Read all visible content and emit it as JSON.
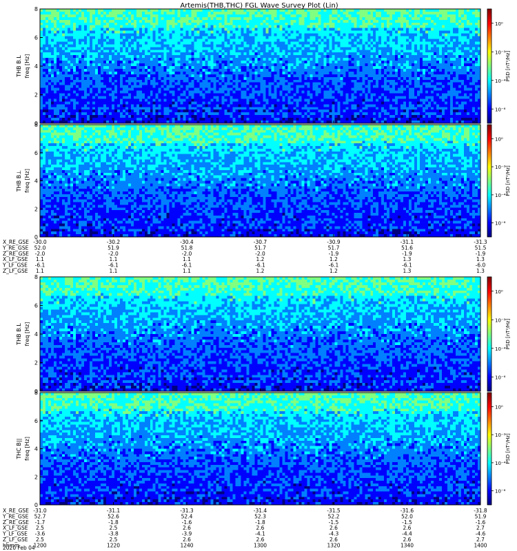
{
  "title": "Artemis(THB,THC) FGL Wave Survey Plot (Lin)",
  "colormap": [
    "#00007f",
    "#0000ff",
    "#0080ff",
    "#00ffff",
    "#80ff80",
    "#ffff00",
    "#ff8000",
    "#ff0000",
    "#7f0000"
  ],
  "chart_data": [
    {
      "type": "heatmap",
      "panel": "p1",
      "probe": "THB",
      "ylabel": "freq [Hz]",
      "band_label": "THB B.L",
      "colorbar_label": "PSD [nT²/Hz]",
      "colorbar_ticks": [
        "10⁰",
        "10⁻²",
        "10⁻⁴",
        "10⁻⁶"
      ],
      "ylim": [
        0,
        8
      ],
      "yticks": [
        "0",
        "2",
        "4",
        "6",
        "8"
      ],
      "zscale": "log",
      "zlim_exp": [
        -7,
        1
      ],
      "xlim": [
        "1200",
        "1400"
      ]
    },
    {
      "type": "heatmap",
      "panel": "p2",
      "probe": "THB",
      "ylabel": "freq [Hz]",
      "band_label": "THB B⊥",
      "colorbar_label": "PSD [nT²/Hz]",
      "colorbar_ticks": [
        "10⁰",
        "10⁻²",
        "10⁻⁴",
        "10⁻⁶"
      ],
      "ylim": [
        0,
        8
      ],
      "yticks": [
        "0",
        "2",
        "4",
        "6",
        "8"
      ],
      "zscale": "log",
      "zlim_exp": [
        -7,
        1
      ],
      "xlim": [
        "1200",
        "1400"
      ]
    },
    {
      "type": "heatmap",
      "panel": "p3",
      "probe": "THB",
      "ylabel": "freq [Hz]",
      "band_label": "THB B.L",
      "colorbar_label": "PSD [nT²/Hz]",
      "colorbar_ticks": [
        "10⁰",
        "10⁻²",
        "10⁻⁴",
        "10⁻⁶"
      ],
      "ylim": [
        0,
        8
      ],
      "yticks": [
        "0",
        "2",
        "4",
        "6",
        "8"
      ],
      "zscale": "log",
      "zlim_exp": [
        -7,
        1
      ],
      "xlim": [
        "1200",
        "1400"
      ]
    },
    {
      "type": "heatmap",
      "panel": "p4",
      "probe": "THC",
      "ylabel": "freq [Hz]",
      "band_label": "THC B||",
      "colorbar_label": "PSD [nT²/Hz]",
      "colorbar_ticks": [
        "10⁰",
        "10⁻²",
        "10⁻⁴",
        "10⁻⁶"
      ],
      "ylim": [
        0,
        8
      ],
      "yticks": [
        "0",
        "2",
        "4",
        "6",
        "8"
      ],
      "zscale": "log",
      "zlim_exp": [
        -7,
        1
      ],
      "xlim": [
        "1200",
        "1400"
      ]
    }
  ],
  "ephem_top": [
    {
      "label": "X_RE_GSE",
      "values": [
        "-30.0",
        "-30.2",
        "-30.4",
        "-30.7",
        "-30.9",
        "-31.1",
        "-31.3"
      ]
    },
    {
      "label": "Y_RE_GSE",
      "values": [
        "52.0",
        "51.9",
        "51.8",
        "51.7",
        "51.7",
        "51.6",
        "51.5"
      ]
    },
    {
      "label": "Z_RE_GSE",
      "values": [
        "-2.0",
        "-2.0",
        "-2.0",
        "-2.0",
        "-1.9",
        "-1.9",
        "-1.9"
      ]
    },
    {
      "label": "X_LF_GSE",
      "values": [
        "1.1",
        "1.1",
        "1.1",
        "1.2",
        "1.2",
        "1.3",
        "1.3"
      ]
    },
    {
      "label": "Y_LF_GSE",
      "values": [
        "-6.1",
        "-6.1",
        "-6.1",
        "-6.1",
        "-6.1",
        "-6.1",
        "-6.0"
      ]
    },
    {
      "label": "Z_LF_GSE",
      "values": [
        "1.1",
        "1.1",
        "1.1",
        "1.2",
        "1.2",
        "1.3",
        "1.3"
      ]
    }
  ],
  "ephem_bottom": [
    {
      "label": "X_RE_GSE",
      "values": [
        "-31.0",
        "-31.1",
        "-31.3",
        "-31.4",
        "-31.5",
        "-31.6",
        "-31.8"
      ]
    },
    {
      "label": "Y_RE_GSE",
      "values": [
        "52.7",
        "52.6",
        "52.4",
        "52.3",
        "52.2",
        "52.0",
        "51.9"
      ]
    },
    {
      "label": "Z_RE_GSE",
      "values": [
        "-1.7",
        "-1.8",
        "-1.6",
        "-1.8",
        "-1.5",
        "-1.5",
        "-1.6"
      ]
    },
    {
      "label": "X_LF_GSE",
      "values": [
        "2.5",
        "2.5",
        "2.6",
        "2.6",
        "2.6",
        "2.6",
        "2.7"
      ]
    },
    {
      "label": "Y_LF_GSE",
      "values": [
        "-3.6",
        "-3.8",
        "-3.9",
        "-4.1",
        "-4.3",
        "-4.4",
        "-4.6"
      ]
    },
    {
      "label": "Z_LF_GSE",
      "values": [
        "2.5",
        "2.5",
        "2.6",
        "2.6",
        "2.6",
        "2.6",
        "2.7"
      ]
    },
    {
      "label": "hhmm",
      "values": [
        "1200",
        "1220",
        "1240",
        "1300",
        "1320",
        "1340",
        "1400"
      ]
    }
  ],
  "date_label": "2020 Feb 04"
}
